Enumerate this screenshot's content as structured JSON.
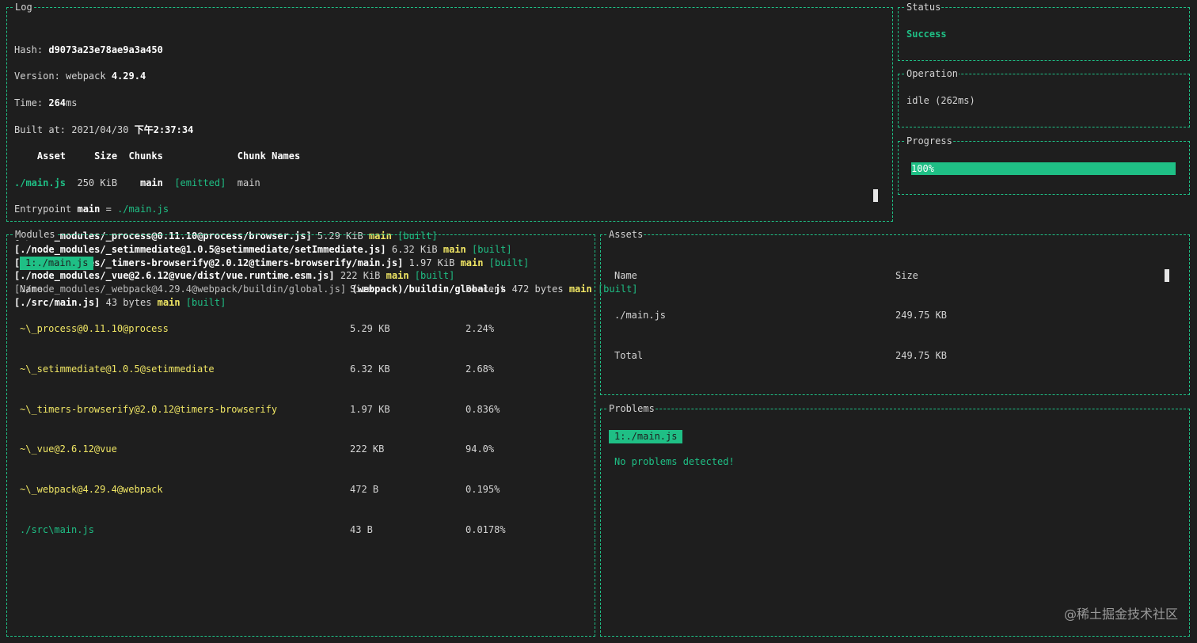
{
  "panels": {
    "log": "Log",
    "status": "Status",
    "operation": "Operation",
    "progress": "Progress",
    "modules": "Modules",
    "assets": "Assets",
    "problems": "Problems"
  },
  "log": {
    "hash_label": "Hash: ",
    "hash": "d9073a23e78ae9a3a450",
    "version_label": "Version: webpack ",
    "version": "4.29.4",
    "time_label": "Time: ",
    "time_value": "264",
    "time_unit": "ms",
    "built_label": "Built at: 2021/04/30 ",
    "built_time": "下午2:37:34",
    "table_header": "    Asset     Size  Chunks             Chunk Names",
    "asset_name": "./main.js",
    "asset_size": "  250 KiB  ",
    "asset_chunk": "  main",
    "asset_status": "  [emitted]",
    "asset_chunk_name": "  main",
    "entry_label": "Entrypoint ",
    "entry_main": "main",
    "entry_eq": " = ",
    "entry_file": "./main.js",
    "modules": [
      {
        "open": "[",
        "path": "./node_modules/_process@0.11.10@process/browser.js",
        "close": "]",
        "size": " 5.29 KiB ",
        "chunk": "main",
        "status": " [built]",
        "bold": true
      },
      {
        "open": "[",
        "path": "./node_modules/_setimmediate@1.0.5@setimmediate/setImmediate.js",
        "close": "]",
        "size": " 6.32 KiB ",
        "chunk": "main",
        "status": " [built]",
        "bold": true
      },
      {
        "open": "[",
        "path": "./node_modules/_timers-browserify@2.0.12@timers-browserify/main.js",
        "close": "]",
        "size": " 1.97 KiB ",
        "chunk": "main",
        "status": " [built]",
        "bold": true
      },
      {
        "open": "[",
        "path": "./node_modules/_vue@2.6.12@vue/dist/vue.runtime.esm.js",
        "close": "]",
        "size": " 222 KiB ",
        "chunk": "main",
        "status": " [built]",
        "bold": true
      },
      {
        "open": "[",
        "path": "./node_modules/_webpack@4.29.4@webpack/buildin/global.js",
        "close": "]",
        "extra": " (webpack)/buildin/global.js",
        "size": " 472 bytes ",
        "chunk": "main",
        "status": " [built]",
        "bold": false
      },
      {
        "open": "[",
        "path": "./src/main.js",
        "close": "]",
        "size": " 43 bytes ",
        "chunk": "main",
        "status": " [built]",
        "bold": true
      }
    ]
  },
  "status": {
    "value": "Success"
  },
  "operation": {
    "value": "idle (262ms)"
  },
  "progress": {
    "percent": 100,
    "label": "100%"
  },
  "modules_panel": {
    "tab": "1:./main.js",
    "headers": {
      "name": "Name",
      "size": "Size",
      "percent": "Percent"
    },
    "rows": [
      {
        "name": "~\\_process@0.11.10@process",
        "size": "5.29 KB",
        "percent": "2.24%",
        "kind": "dep"
      },
      {
        "name": "~\\_setimmediate@1.0.5@setimmediate",
        "size": "6.32 KB",
        "percent": "2.68%",
        "kind": "dep"
      },
      {
        "name": "~\\_timers-browserify@2.0.12@timers-browserify",
        "size": "1.97 KB",
        "percent": "0.836%",
        "kind": "dep"
      },
      {
        "name": "~\\_vue@2.6.12@vue",
        "size": "222 KB",
        "percent": "94.0%",
        "kind": "dep"
      },
      {
        "name": "~\\_webpack@4.29.4@webpack",
        "size": "472 B",
        "percent": "0.195%",
        "kind": "dep"
      },
      {
        "name": "./src\\main.js",
        "size": "43 B",
        "percent": "0.0178%",
        "kind": "src"
      }
    ]
  },
  "assets_panel": {
    "headers": {
      "name": "Name",
      "size": "Size"
    },
    "rows": [
      {
        "name": "./main.js",
        "size": "249.75 KB"
      },
      {
        "name": "Total",
        "size": "249.75 KB"
      }
    ]
  },
  "problems_panel": {
    "tab": "1:./main.js",
    "message": "No problems detected!"
  },
  "watermark": "@稀土掘金技术社区",
  "colors": {
    "accent": "#1fbf85",
    "module_name": "#f0e664",
    "background": "#1e1e1e"
  }
}
